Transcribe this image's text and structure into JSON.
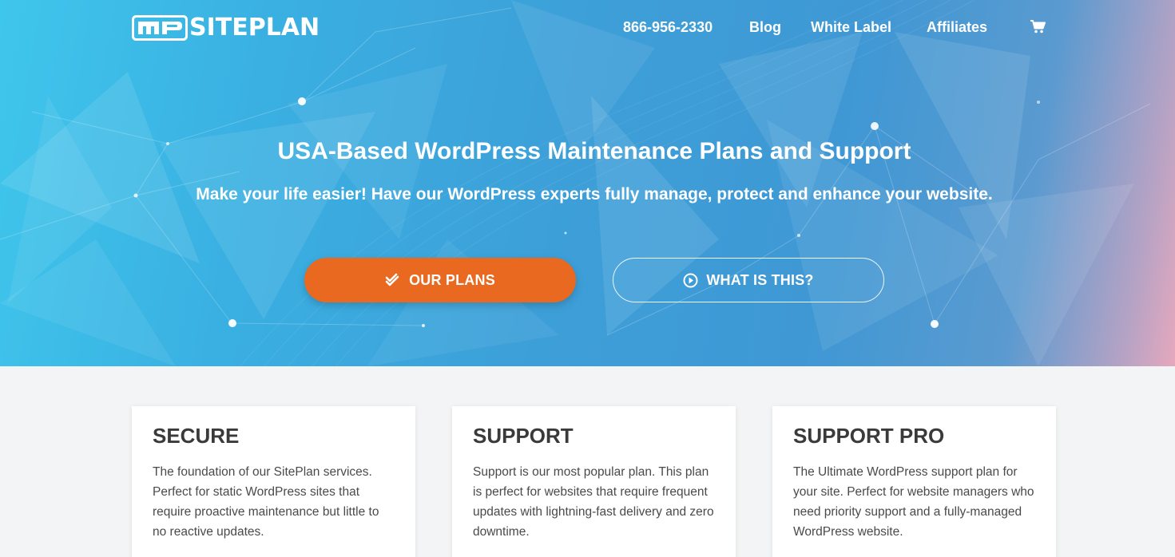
{
  "brand": {
    "name": "SITEPLAN",
    "colors": {
      "accent": "#e8691f",
      "hero_blue": "#3d9fd8",
      "card_title": "#3a3a3a"
    }
  },
  "nav": {
    "phone": "866-956-2330",
    "blog": "Blog",
    "white_label": "White Label",
    "affiliates": "Affiliates",
    "cart_icon": "cart-icon"
  },
  "hero": {
    "title": "USA-Based WordPress Maintenance Plans and Support",
    "subtitle": "Make your life easier! Have our WordPress experts fully manage, protect and enhance your website.",
    "plans_button": "OUR PLANS",
    "what_button": "WHAT IS THIS?"
  },
  "plans": [
    {
      "title": "SECURE",
      "description": "The foundation of our SitePlan services. Perfect for static WordPress sites that require proactive maintenance but little to no reactive updates."
    },
    {
      "title": "SUPPORT",
      "description": "Support is our most popular plan. This plan is perfect for websites that require frequent updates with lightning-fast delivery and zero downtime."
    },
    {
      "title": "SUPPORT PRO",
      "description": "The Ultimate WordPress support plan for your site. Perfect for website managers who need priority support and a fully-managed WordPress website."
    }
  ]
}
